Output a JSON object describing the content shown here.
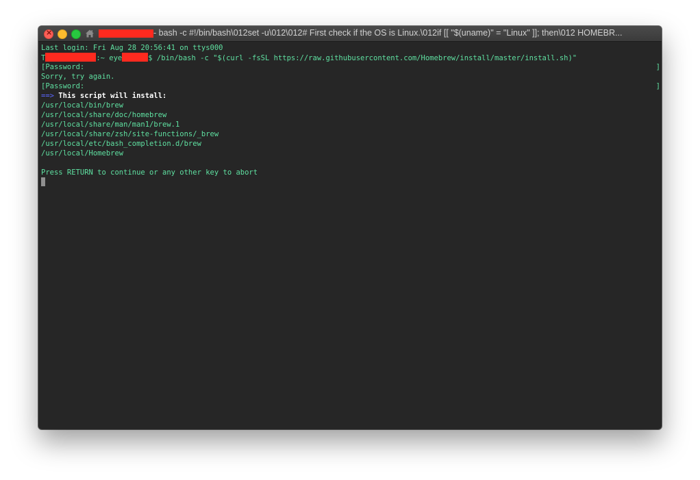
{
  "window": {
    "title": "- bash -c #!/bin/bash\\012set -u\\012\\012# First check if the OS is Linux.\\012if [[ \"$(uname)\" = \"Linux\" ]]; then\\012  HOMEBR..."
  },
  "terminal": {
    "last_login": "Last login: Fri Aug 28 20:56:41 on ttys000",
    "prompt_prefix": "T",
    "prompt_mid": ":~ eye",
    "prompt_suffix": "$ ",
    "command": "/bin/bash -c \"$(curl -fsSL https://raw.githubusercontent.com/Homebrew/install/master/install.sh)\"",
    "bracket_left": "[",
    "bracket_right": "]",
    "password_prompt": "Password:",
    "sorry": "Sorry, try again.",
    "arrow": "==>",
    "install_heading": "This script will install:",
    "paths": [
      "/usr/local/bin/brew",
      "/usr/local/share/doc/homebrew",
      "/usr/local/share/man/man1/brew.1",
      "/usr/local/share/zsh/site-functions/_brew",
      "/usr/local/etc/bash_completion.d/brew",
      "/usr/local/Homebrew"
    ],
    "press_return": "Press RETURN to continue or any other key to abort"
  },
  "colors": {
    "terminal_bg": "#262626",
    "terminal_text": "#5fe0a1",
    "arrow": "#5b67ff",
    "redaction": "#ff2a1f"
  },
  "icons": [
    "close-icon",
    "home-icon"
  ]
}
